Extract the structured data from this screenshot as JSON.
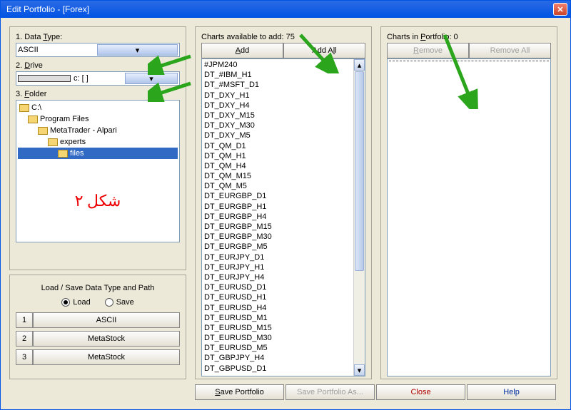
{
  "window": {
    "title": "Edit Portfolio - [Forex]"
  },
  "left": {
    "dataTypeLabel": "1. Data Type:",
    "dataTypeValue": "ASCII",
    "driveLabel": "2. Drive",
    "driveValue": "c: [ ]",
    "folderLabel": "3. Folder",
    "tree": [
      {
        "label": "C:\\",
        "indent": 0
      },
      {
        "label": "Program Files",
        "indent": 1
      },
      {
        "label": "MetaTrader - Alpari",
        "indent": 2
      },
      {
        "label": "experts",
        "indent": 3
      },
      {
        "label": "files",
        "indent": 4,
        "selected": true
      }
    ],
    "shapeText": "شكل ۲"
  },
  "presets": {
    "title": "Load / Save Data Type and Path",
    "loadLabel": "Load",
    "saveLabel": "Save",
    "rows": [
      {
        "num": "1",
        "label": "ASCII"
      },
      {
        "num": "2",
        "label": "MetaStock"
      },
      {
        "num": "3",
        "label": "MetaStock"
      }
    ]
  },
  "mid": {
    "header": "Charts available to add: 75",
    "addLabel": "Add",
    "addAllLabel": "Add All",
    "items": [
      "#JPM240",
      "DT_#IBM_H1",
      "DT_#MSFT_D1",
      "DT_DXY_H1",
      "DT_DXY_H4",
      "DT_DXY_M15",
      "DT_DXY_M30",
      "DT_DXY_M5",
      "DT_QM_D1",
      "DT_QM_H1",
      "DT_QM_H4",
      "DT_QM_M15",
      "DT_QM_M5",
      "DT_EURGBP_D1",
      "DT_EURGBP_H1",
      "DT_EURGBP_H4",
      "DT_EURGBP_M15",
      "DT_EURGBP_M30",
      "DT_EURGBP_M5",
      "DT_EURJPY_D1",
      "DT_EURJPY_H1",
      "DT_EURJPY_H4",
      "DT_EURUSD_D1",
      "DT_EURUSD_H1",
      "DT_EURUSD_H4",
      "DT_EURUSD_M1",
      "DT_EURUSD_M15",
      "DT_EURUSD_M30",
      "DT_EURUSD_M5",
      "DT_GBPJPY_H4",
      "DT_GBPUSD_D1"
    ]
  },
  "right": {
    "header": "Charts in Portfolio: 0",
    "removeLabel": "Remove",
    "removeAllLabel": "Remove All"
  },
  "bottom": {
    "save": "Save Portfolio",
    "saveAs": "Save Portfolio As...",
    "close": "Close",
    "help": "Help"
  },
  "colors": {
    "accentGreen": "#2aa51c"
  }
}
